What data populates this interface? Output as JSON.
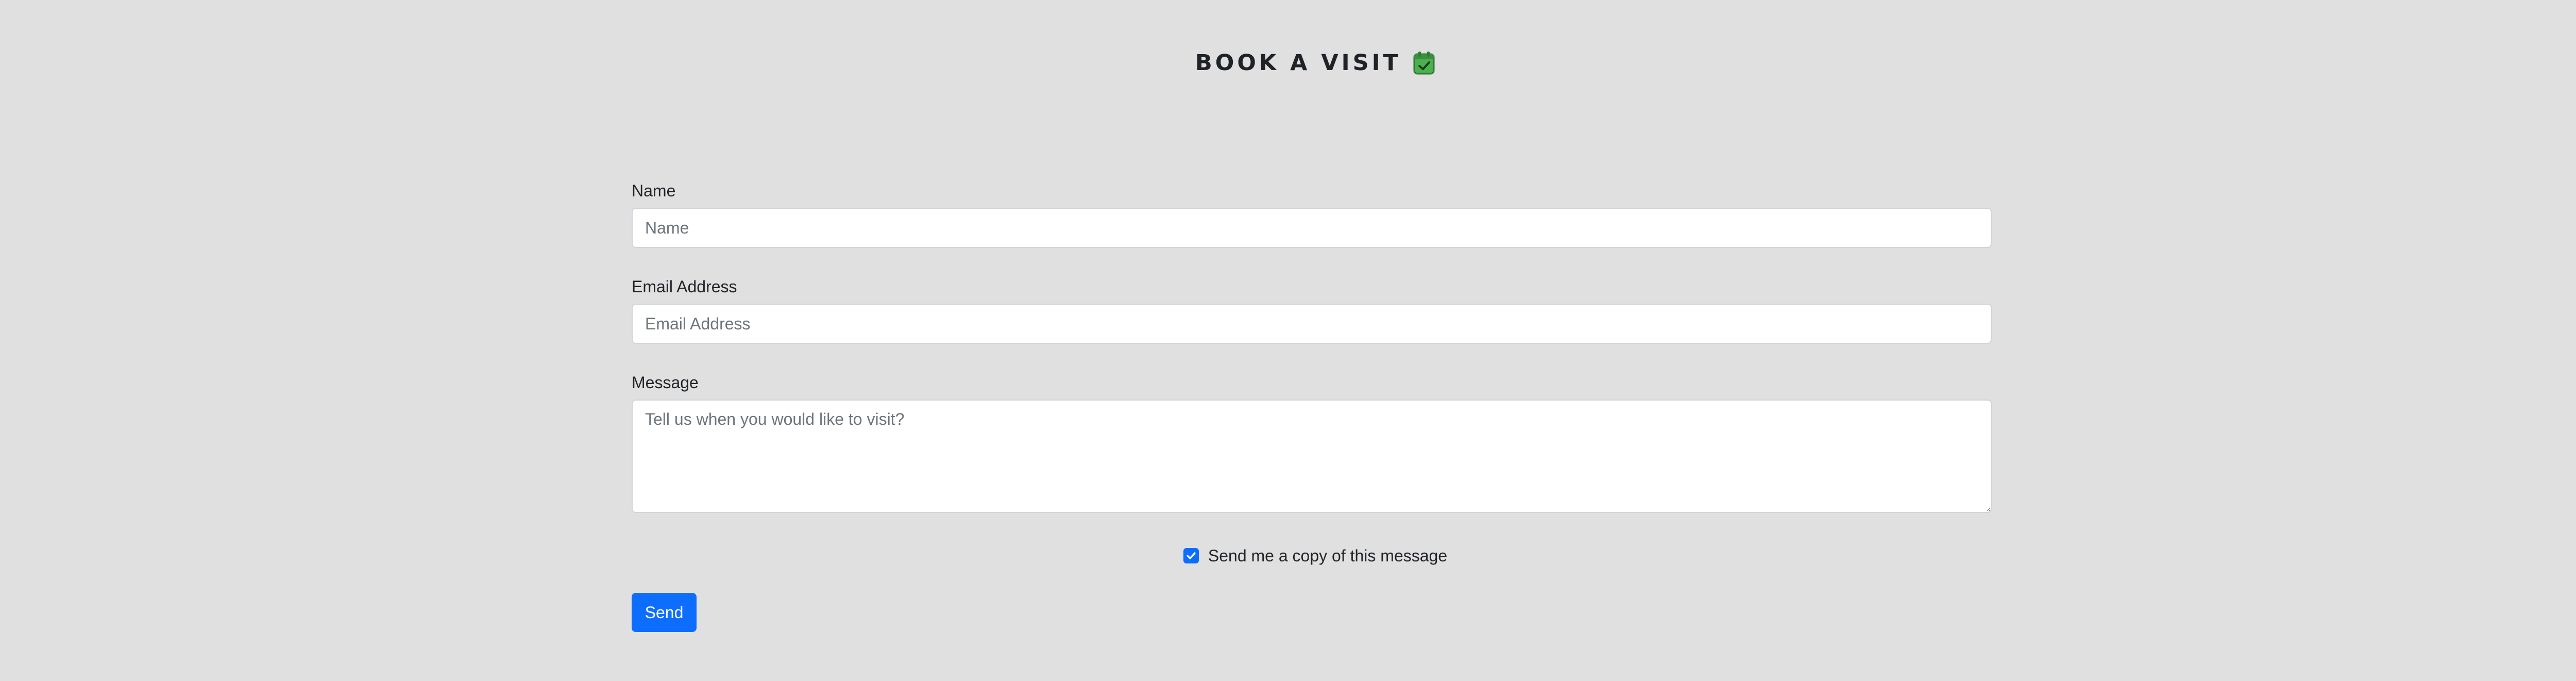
{
  "header": {
    "title": "BOOK A VISIT",
    "icon": "calendar-check-icon"
  },
  "form": {
    "name": {
      "label": "Name",
      "value": "",
      "placeholder": "Name"
    },
    "email": {
      "label": "Email Address",
      "value": "",
      "placeholder": "Email Address"
    },
    "message": {
      "label": "Message",
      "value": "",
      "placeholder": "Tell us when you would like to visit?"
    },
    "copy_checkbox": {
      "label": "Send me a copy of this message",
      "checked": true
    },
    "send_label": "Send"
  },
  "colors": {
    "background": "#e0e0e0",
    "primary": "#0d6efd",
    "icon_green": "#4caf50"
  }
}
